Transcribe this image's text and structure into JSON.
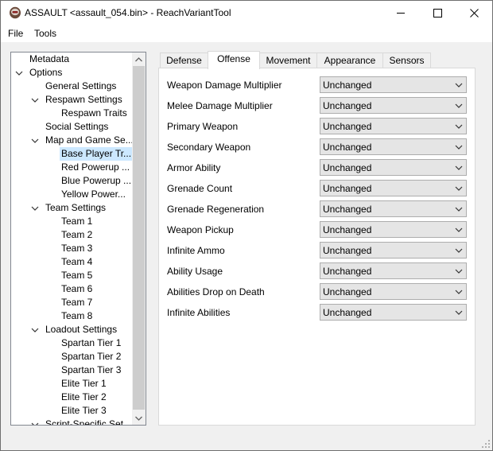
{
  "window": {
    "title": "ASSAULT <assault_054.bin> - ReachVariantTool",
    "minimize_icon": "minimize-icon",
    "maximize_icon": "maximize-icon",
    "close_icon": "close-icon"
  },
  "menubar": {
    "items": [
      "File",
      "Tools"
    ]
  },
  "tree": {
    "rows": [
      {
        "label": "Metadata",
        "expander": "none"
      },
      {
        "label": "Options",
        "expander": "expanded"
      },
      {
        "label": "General Settings",
        "expander": "none"
      },
      {
        "label": "Respawn Settings",
        "expander": "expanded"
      },
      {
        "label": "Respawn Traits",
        "expander": "none"
      },
      {
        "label": "Social Settings",
        "expander": "none"
      },
      {
        "label": "Map and Game Se...",
        "expander": "expanded"
      },
      {
        "label": "Base Player Tr...",
        "expander": "none",
        "selected": true
      },
      {
        "label": "Red Powerup ...",
        "expander": "none"
      },
      {
        "label": "Blue Powerup ...",
        "expander": "none"
      },
      {
        "label": "Yellow Power...",
        "expander": "none"
      },
      {
        "label": "Team Settings",
        "expander": "expanded"
      },
      {
        "label": "Team 1",
        "expander": "none"
      },
      {
        "label": "Team 2",
        "expander": "none"
      },
      {
        "label": "Team 3",
        "expander": "none"
      },
      {
        "label": "Team 4",
        "expander": "none"
      },
      {
        "label": "Team 5",
        "expander": "none"
      },
      {
        "label": "Team 6",
        "expander": "none"
      },
      {
        "label": "Team 7",
        "expander": "none"
      },
      {
        "label": "Team 8",
        "expander": "none"
      },
      {
        "label": "Loadout Settings",
        "expander": "expanded"
      },
      {
        "label": "Spartan Tier 1",
        "expander": "none"
      },
      {
        "label": "Spartan Tier 2",
        "expander": "none"
      },
      {
        "label": "Spartan Tier 3",
        "expander": "none"
      },
      {
        "label": "Elite Tier 1",
        "expander": "none"
      },
      {
        "label": "Elite Tier 2",
        "expander": "none"
      },
      {
        "label": "Elite Tier 3",
        "expander": "none"
      },
      {
        "label": "Script-Specific Set...",
        "expander": "expanded"
      }
    ]
  },
  "tabs": [
    {
      "label": "Defense"
    },
    {
      "label": "Offense",
      "active": true
    },
    {
      "label": "Movement"
    },
    {
      "label": "Appearance"
    },
    {
      "label": "Sensors"
    }
  ],
  "offense": {
    "fields": [
      {
        "label": "Weapon Damage Multiplier",
        "value": "Unchanged"
      },
      {
        "label": "Melee Damage Multiplier",
        "value": "Unchanged"
      },
      {
        "label": "Primary Weapon",
        "value": "Unchanged"
      },
      {
        "label": "Secondary Weapon",
        "value": "Unchanged"
      },
      {
        "label": "Armor Ability",
        "value": "Unchanged"
      },
      {
        "label": "Grenade Count",
        "value": "Unchanged"
      },
      {
        "label": "Grenade Regeneration",
        "value": "Unchanged"
      },
      {
        "label": "Weapon Pickup",
        "value": "Unchanged"
      },
      {
        "label": "Infinite Ammo",
        "value": "Unchanged"
      },
      {
        "label": "Ability Usage",
        "value": "Unchanged"
      },
      {
        "label": "Abilities Drop on Death",
        "value": "Unchanged"
      },
      {
        "label": "Infinite Abilities",
        "value": "Unchanged"
      }
    ]
  }
}
